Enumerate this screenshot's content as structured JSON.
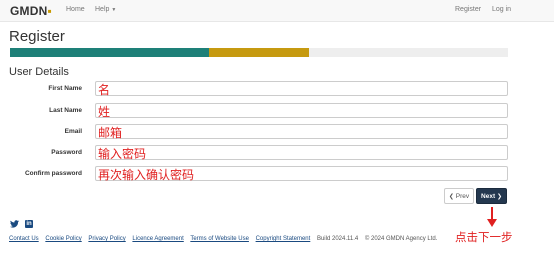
{
  "navbar": {
    "logo_main": "GMDN",
    "logo_accent": "▪",
    "home": "Home",
    "help": "Help",
    "register": "Register",
    "login": "Log in"
  },
  "title": "Register",
  "progress": {
    "steps": [
      {
        "state": "complete",
        "color": "#1e8078"
      },
      {
        "state": "current",
        "color": "#c69a10"
      },
      {
        "state": "pending",
        "color": "#eeeeee"
      }
    ]
  },
  "section": "User Details",
  "form": {
    "first_name": {
      "label": "First Name",
      "annotation": "名"
    },
    "last_name": {
      "label": "Last Name",
      "annotation": "姓"
    },
    "email": {
      "label": "Email",
      "annotation": "邮箱"
    },
    "password": {
      "label": "Password",
      "annotation": "输入密码"
    },
    "confirm_password": {
      "label": "Confirm password",
      "annotation": "再次输入确认密码"
    }
  },
  "buttons": {
    "prev": "Prev",
    "next": "Next"
  },
  "annotation_next": "点击下一步",
  "social": {
    "linkedin": "in"
  },
  "footer": {
    "links": [
      "Contact Us",
      "Cookie Policy",
      "Privacy Policy",
      "Licence Agreement",
      "Terms of Website Use",
      "Copyright Statement"
    ],
    "build": "Build 2024.11.4",
    "copyright": "© 2024 GMDN Agency Ltd."
  },
  "colors": {
    "annotation": "#e02020",
    "next_button": "#24384f",
    "link": "#1a4a80"
  }
}
